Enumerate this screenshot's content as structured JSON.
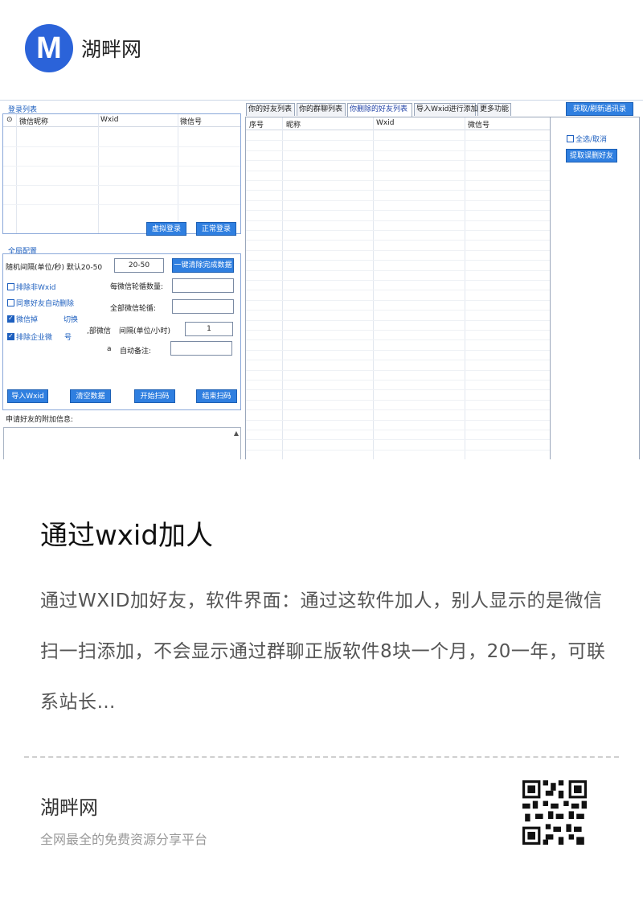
{
  "site": {
    "logo_letter": "M",
    "name": "湖畔网"
  },
  "app": {
    "login_group_title": "登录列表",
    "login_headers": [
      "⊙",
      "微信昵称",
      "Wxid",
      "微信号"
    ],
    "virtual_login": "虚拟登录",
    "normal_login": "正常登录",
    "global_group_title": "全局配置",
    "interval_label": "随机间隔(单位/秒) 默认20-50",
    "interval_value": "20-50",
    "clear_button": "一键清除完成数据",
    "exclude_non_wxid": "排除非Wxid",
    "agree_auto_delete": "同意好友自动删除",
    "wechat_switch_a": "微信掉",
    "wechat_switch_b": "切换",
    "exclude_enterprise_a": "排除企业微",
    "exclude_enterprise_b": "号",
    "per_rotation_label": "每微信轮循数量:",
    "all_rotation_label": "全部微信轮循:",
    "rotation_interval_label_a": ",部微信",
    "rotation_interval_label_b": "间隔(单位/小时)",
    "rotation_interval_value": "1",
    "auto_note_label_a": "a",
    "auto_note_label_b": "自动备注:",
    "import_wxid": "导入Wxid",
    "clear_data": "清空数据",
    "start_scan": "开始扫码",
    "end_scan": "结束扫码",
    "friend_info_label": "申请好友的附加信息:",
    "tabs": [
      "你的好友列表",
      "你的群聊列表",
      "你删除的好友列表",
      "导入Wxid进行添加",
      "更多功能"
    ],
    "right_headers": [
      "序号",
      "昵称",
      "Wxid",
      "微信号"
    ],
    "fetch_button": "获取/刷新通讯录",
    "select_all": "全选/取消",
    "extract_button": "提取误删好友"
  },
  "article": {
    "title": "通过wxid加人",
    "description": "通过WXID加好友，软件界面：通过这软件加人，别人显示的是微信扫一扫添加，不会显示通过群聊正版软件8块一个月，20一年，可联系站长…"
  },
  "footer": {
    "name": "湖畔网",
    "subtitle": "全网最全的免费资源分享平台"
  },
  "colors": {
    "brand": "#2b63d9",
    "button": "#2f7fe0",
    "group_title": "#1d5fbf"
  },
  "icons": {
    "qr": "qr-code-icon",
    "scroll": "scroll-up-icon"
  }
}
